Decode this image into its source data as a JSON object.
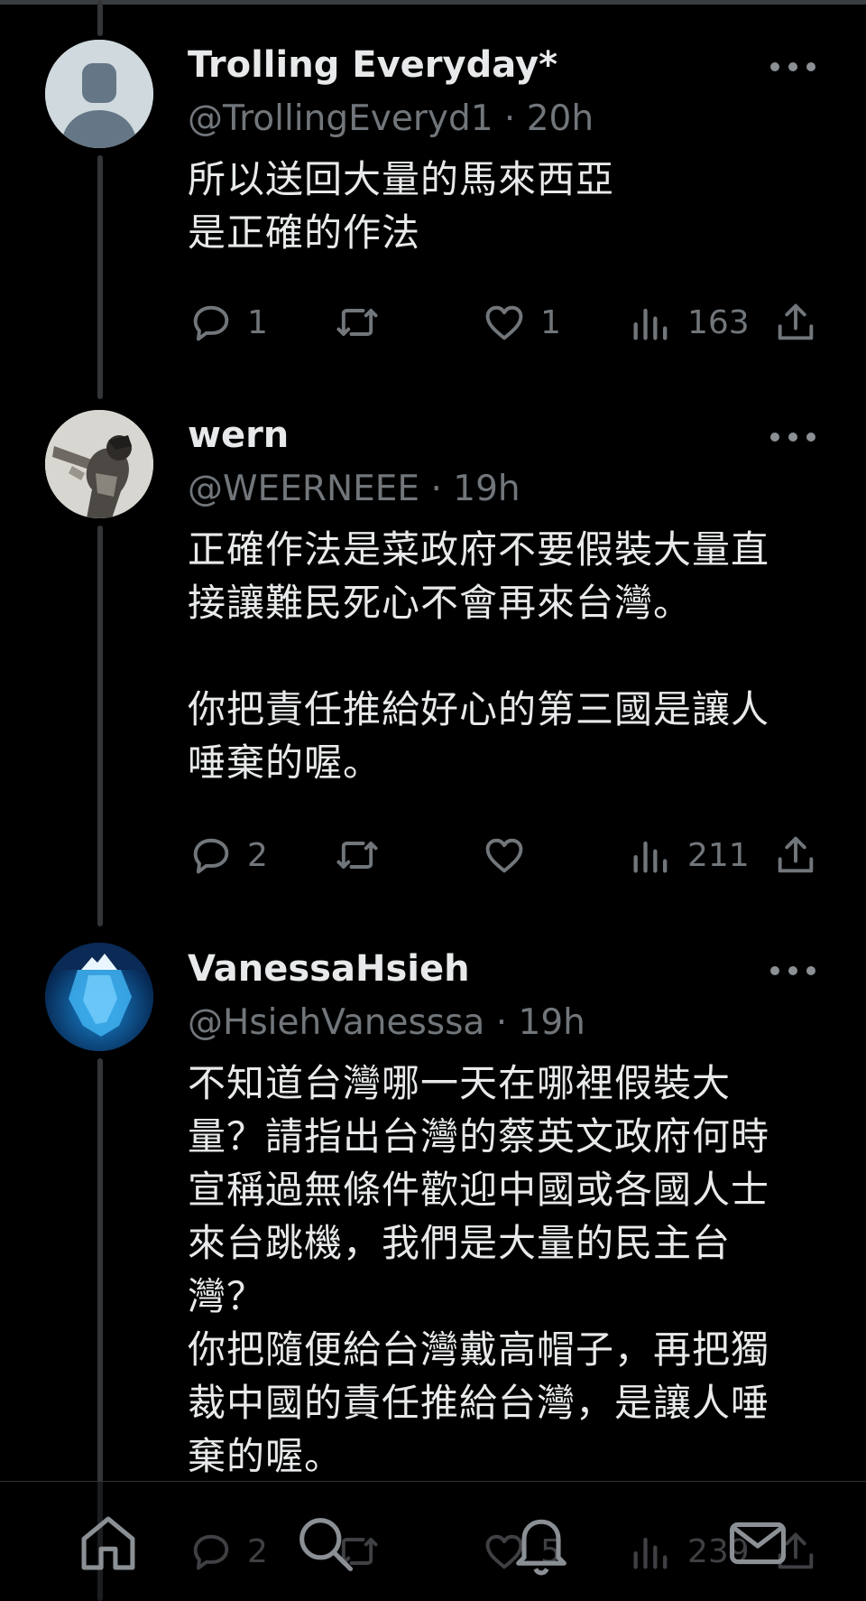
{
  "tweets": [
    {
      "name": "Trolling Everyday*",
      "handle": "@TrollingEveryd1",
      "time": "20h",
      "text": "所以送回大量的馬來西亞\n是正確的作法",
      "replies": "1",
      "retweets": "",
      "likes": "1",
      "views": "163",
      "avatar": "default-profile-icon"
    },
    {
      "name": "wern",
      "handle": "@WEERNEEE",
      "time": "19h",
      "text": "正確作法是菜政府不要假裝大量直\n接讓難民死心不會再來台灣。\n\n你把責任推給好心的第三國是讓人\n唾棄的喔。",
      "replies": "2",
      "retweets": "",
      "likes": "",
      "views": "211",
      "avatar": "armored-figure-icon"
    },
    {
      "name": "VanessaHsieh",
      "handle": "@HsiehVanesssa",
      "time": "19h",
      "text": "不知道台灣哪一天在哪裡假裝大\n量？請指出台灣的蔡英文政府何時\n宣稱過無條件歡迎中國或各國人士\n來台跳機，我們是大量的民主台\n灣？\n你把隨便給台灣戴高帽子，再把獨\n裁中國的責任推給台灣，是讓人唾\n棄的喔。",
      "replies": "2",
      "retweets": "",
      "likes": "5",
      "views": "239",
      "avatar": "iceberg-icon"
    }
  ],
  "separator": "·",
  "nav": {
    "items": [
      "home-icon",
      "search-icon",
      "notifications-icon",
      "messages-icon"
    ]
  },
  "colors": {
    "background": "#000000",
    "text": "#e7e9ea",
    "secondary": "#71767b",
    "thread_line": "#333639"
  }
}
